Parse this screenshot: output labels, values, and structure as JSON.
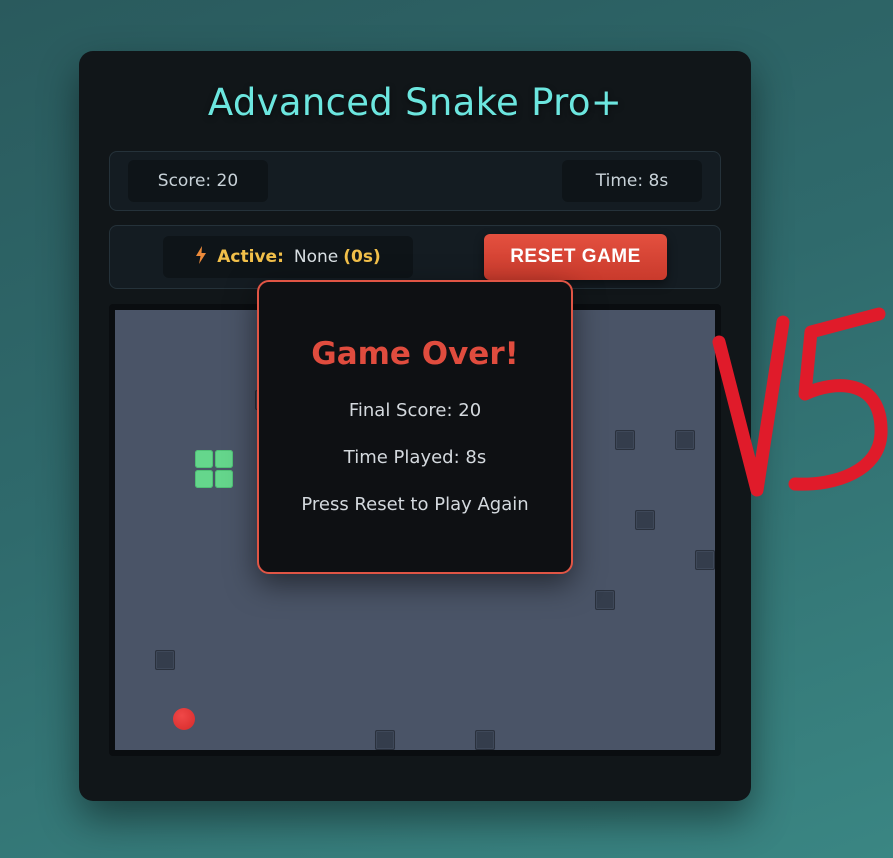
{
  "title": "Advanced Snake Pro+",
  "stats": {
    "score": "Score: 20",
    "time": "Time: 8s"
  },
  "powerup": {
    "icon": "lightning-bolt-icon",
    "label": "Active:",
    "value": "None",
    "timer": "(0s)"
  },
  "reset_button": "RESET GAME",
  "game_over": {
    "title": "Game Over!",
    "final_score": "Final Score: 20",
    "time_played": "Time Played: 8s",
    "prompt": "Press Reset to Play Again"
  },
  "annotation": "VS",
  "colors": {
    "accent": "#6ce6df",
    "danger": "#e04c3e",
    "snake": "#65d68c",
    "food": "#e03a3a",
    "board": "#4a5467"
  }
}
